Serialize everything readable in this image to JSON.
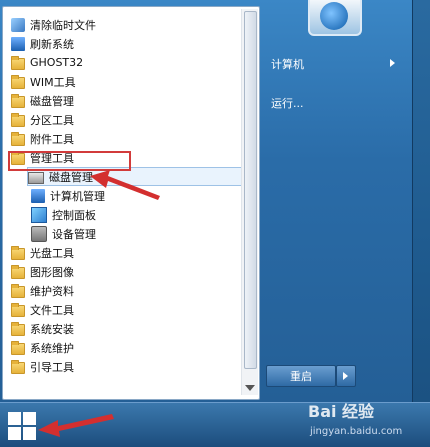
{
  "programs": [
    {
      "label": "清除临时文件",
      "icon": "tool-icon"
    },
    {
      "label": "刷新系统",
      "icon": "computer-icon"
    },
    {
      "label": "GHOST32",
      "icon": "folder-icon"
    },
    {
      "label": "WIM工具",
      "icon": "folder-icon"
    },
    {
      "label": "磁盘管理",
      "icon": "folder-icon"
    },
    {
      "label": "分区工具",
      "icon": "folder-icon"
    },
    {
      "label": "附件工具",
      "icon": "folder-icon"
    },
    {
      "label": "管理工具",
      "icon": "folder-icon"
    },
    {
      "label": "磁盘管理",
      "icon": "disk-icon"
    },
    {
      "label": "计算机管理",
      "icon": "computer-management-icon"
    },
    {
      "label": "控制面板",
      "icon": "control-panel-icon"
    },
    {
      "label": "设备管理",
      "icon": "device-manager-icon"
    },
    {
      "label": "光盘工具",
      "icon": "folder-icon"
    },
    {
      "label": "图形图像",
      "icon": "folder-icon"
    },
    {
      "label": "维护资料",
      "icon": "folder-icon"
    },
    {
      "label": "文件工具",
      "icon": "folder-icon"
    },
    {
      "label": "系统安装",
      "icon": "folder-icon"
    },
    {
      "label": "系统维护",
      "icon": "folder-icon"
    },
    {
      "label": "引导工具",
      "icon": "folder-icon"
    }
  ],
  "right_panel": {
    "computer_label": "计算机",
    "run_label": "运行..."
  },
  "restart_label": "重启",
  "watermark": {
    "brand": "Bai 经验",
    "url": "jingyan.baidu.com"
  },
  "colors": {
    "highlight_box": "#d23b3b",
    "selection": "#e9f3fd",
    "accent": "#2a6ca8"
  }
}
